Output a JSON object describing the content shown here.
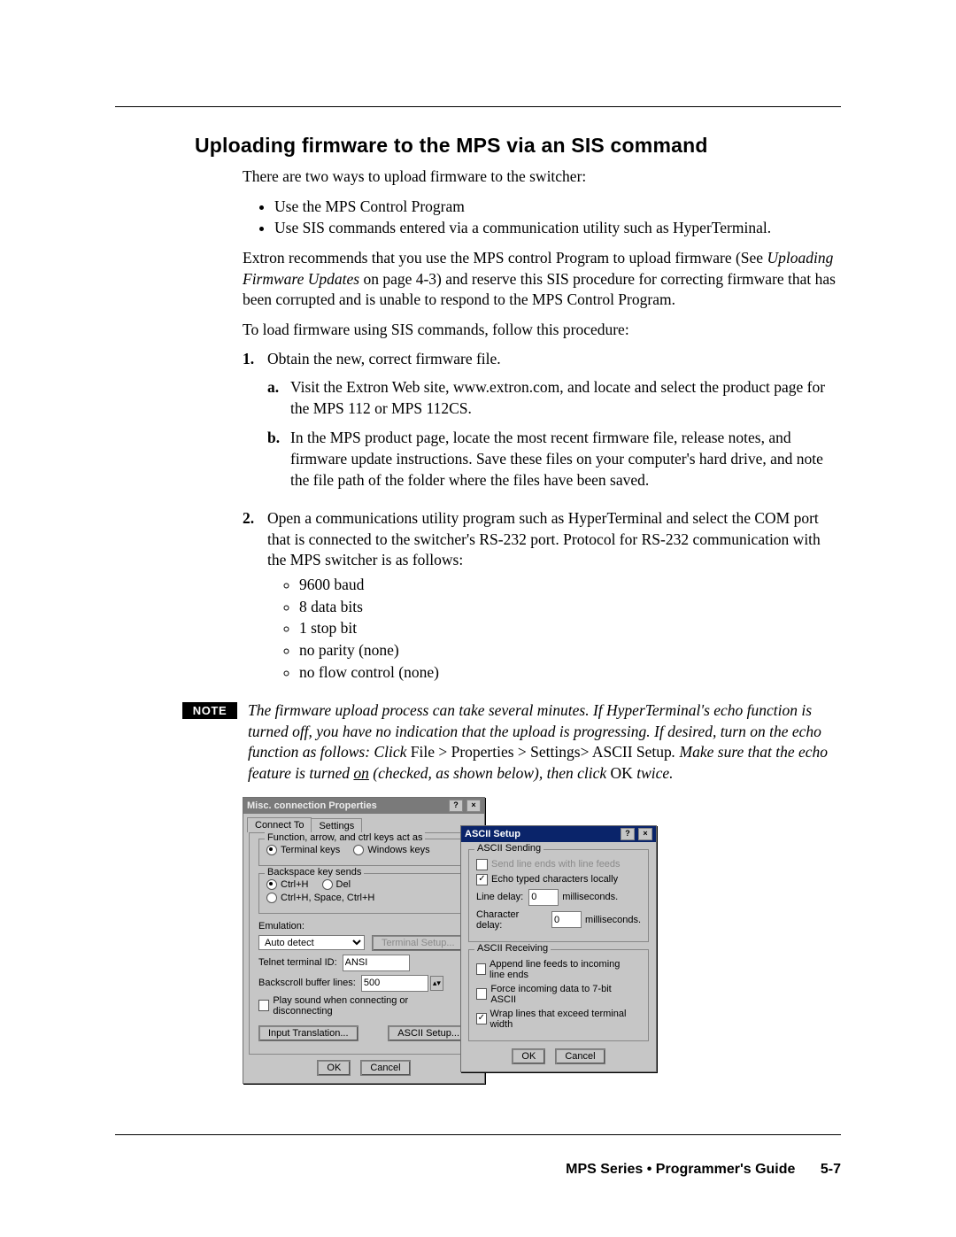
{
  "heading": "Uploading firmware to the MPS via an SIS command",
  "intro": "There are two ways to upload firmware to the switcher:",
  "intro_bullets": [
    "Use the MPS Control Program",
    "Use SIS commands entered via a communication utility such as HyperTerminal."
  ],
  "rec_part1": "Extron recommends that you use the MPS control Program to upload firmware (See ",
  "rec_italic": "Uploading Firmware Updates",
  "rec_part2": " on page 4-3) and reserve this SIS procedure for correcting firmware that has been corrupted and is unable to respond to the MPS Control Program.",
  "proc_lead": "To load firmware using SIS commands, follow this procedure:",
  "step1_num": "1.",
  "step1_text": "Obtain the new, correct firmware file.",
  "step1a_let": "a.",
  "step1a_text": "Visit the Extron Web site, www.extron.com, and locate and select the product page for the MPS 112 or MPS 112CS.",
  "step1b_let": "b.",
  "step1b_text": "In the MPS product page, locate the most recent firmware file, release notes, and firmware update instructions.  Save these files on your computer's hard drive, and note the file path of the folder where the files have been saved.",
  "step2_num": "2.",
  "step2_text": "Open a communications utility program such as HyperTerminal and select the COM port that is connected to the switcher's RS-232 port.  Protocol for RS-232 communication with the MPS switcher is as follows:",
  "step2_bullets": [
    "9600 baud",
    "8 data bits",
    "1 stop bit",
    "no parity (none)",
    "no flow control (none)"
  ],
  "note_badge": "NOTE",
  "note_seg1": "The firmware upload process can take several minutes.  If HyperTerminal's echo function is turned off, you have no indication that the upload is progressing.  If desired, turn on the echo function as follows: Click ",
  "note_roman1": "File > Properties > Settings> ASCII Setup",
  "note_seg2": ".  Make sure that the echo feature is turned ",
  "note_underline": "on",
  "note_seg3": " (checked, as shown below), then click ",
  "note_roman2": "OK",
  "note_seg4": " twice.",
  "dialog1": {
    "title": "Misc. connection Properties",
    "tab1": "Connect To",
    "tab2": "Settings",
    "grp1_title": "Function, arrow, and ctrl keys act as",
    "grp1_opt1": "Terminal keys",
    "grp1_opt2": "Windows keys",
    "grp2_title": "Backspace key sends",
    "grp2_opt1": "Ctrl+H",
    "grp2_opt2": "Del",
    "grp2_opt3": "Ctrl+H, Space, Ctrl+H",
    "emu_label": "Emulation:",
    "emu_value": "Auto detect",
    "term_setup_btn": "Terminal Setup...",
    "telnet_label": "Telnet terminal ID:",
    "telnet_value": "ANSI",
    "buf_label": "Backscroll buffer lines:",
    "buf_value": "500",
    "playsound": "Play sound when connecting or disconnecting",
    "input_trans_btn": "Input Translation...",
    "ascii_btn": "ASCII Setup...",
    "ok": "OK",
    "cancel": "Cancel"
  },
  "dialog2": {
    "title": "ASCII Setup",
    "send_title": "ASCII Sending",
    "send_chk1": "Send line ends with line feeds",
    "send_chk2": "Echo typed characters locally",
    "line_delay_label": "Line delay:",
    "line_delay_value": "0",
    "line_delay_unit": "milliseconds.",
    "char_delay_label": "Character delay:",
    "char_delay_value": "0",
    "char_delay_unit": "milliseconds.",
    "recv_title": "ASCII Receiving",
    "recv_chk1": "Append line feeds to incoming line ends",
    "recv_chk2": "Force incoming data to 7-bit ASCII",
    "recv_chk3": "Wrap lines that exceed terminal width",
    "ok": "OK",
    "cancel": "Cancel"
  },
  "footer_title": "MPS Series • Programmer's Guide",
  "footer_page": "5-7"
}
